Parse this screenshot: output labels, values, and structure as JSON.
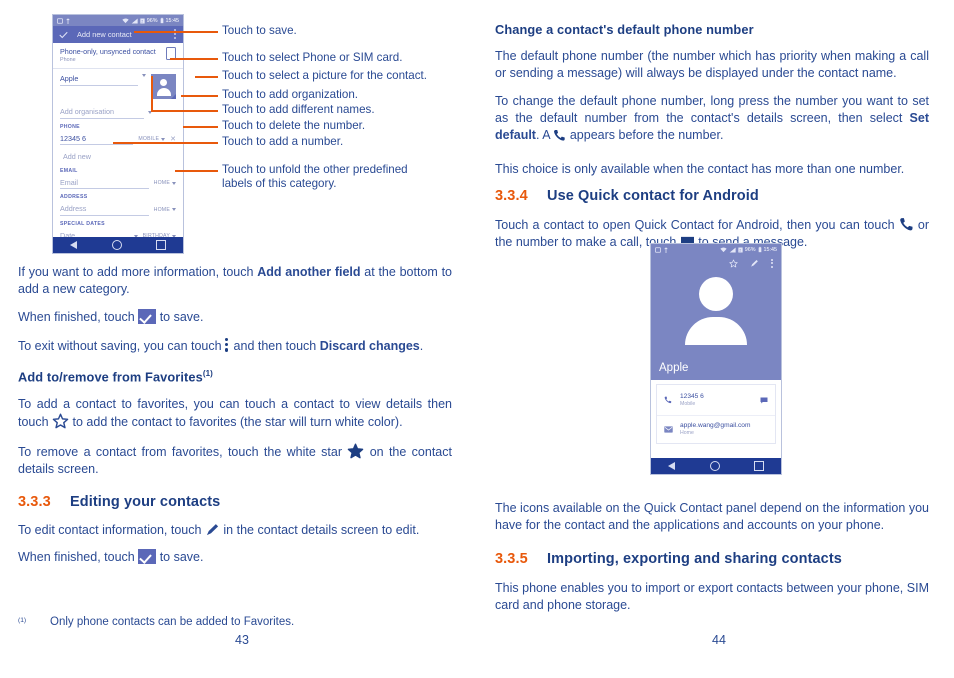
{
  "document": {
    "left_page_number": "43",
    "right_page_number": "44"
  },
  "colors": {
    "body_text": "#2a4a93",
    "heading": "#1d3e82",
    "accent_orange": "#e8590c",
    "phone_appbar": "#5b68b8",
    "phone_navbar": "#1f3a93",
    "phone_statusbar": "#7b86c2"
  },
  "left_column": {
    "phone_add_contact": {
      "statusbar": {
        "battery": "96%",
        "time": "15:45",
        "icons": [
          "sim-card-icon",
          "usb-icon",
          "wifi-icon",
          "signal-icon",
          "battery-icon"
        ]
      },
      "appbar": {
        "check_icon": "check-icon",
        "title": "Add new contact",
        "overflow_icon": "overflow-menu-icon"
      },
      "account_row": {
        "primary": "Phone-only, unsynced contact",
        "secondary": "Phone",
        "icon": "sim-card-icon"
      },
      "name_field": {
        "value": "Apple",
        "expand_icon": "chevron-down-icon"
      },
      "photo_icon": "contact-photo-icon",
      "organisation_field": {
        "placeholder": "Add organisation",
        "expand_icon": "chevron-down-icon"
      },
      "sections": [
        {
          "title": "PHONE",
          "rows": [
            {
              "value": "12345 6",
              "label": "MOBILE",
              "delete_icon": "close-icon"
            },
            {
              "value": "Add new",
              "label": ""
            }
          ]
        },
        {
          "title": "EMAIL",
          "rows": [
            {
              "value": "Email",
              "label": "HOME",
              "placeholder": true
            }
          ]
        },
        {
          "title": "ADDRESS",
          "rows": [
            {
              "value": "Address",
              "label": "HOME",
              "placeholder": true
            }
          ]
        },
        {
          "title": "SPECIAL DATES",
          "rows": [
            {
              "value": "Date",
              "label": "BIRTHDAY",
              "placeholder": true
            }
          ]
        }
      ],
      "navbar": [
        "back-icon",
        "home-icon",
        "recents-icon"
      ]
    },
    "callouts": [
      "Touch to save.",
      "Touch to select Phone or SIM card.",
      "Touch to select a picture for the contact.",
      "Touch to add organization.",
      "Touch to add different names.",
      "Touch to delete the number.",
      "Touch to add a number.",
      "Touch to unfold the other predefined labels of this category."
    ],
    "paragraphs": {
      "p1_pre": "If you want to add more information, touch ",
      "p1_bold": "Add another field",
      "p1_post": " at the bottom to add a new category.",
      "p2_pre": "When finished, touch ",
      "p2_post": " to save.",
      "p3_pre": "To exit without saving, you can touch ",
      "p3_mid": " and then touch ",
      "p3_bold": "Discard changes",
      "p3_post": ".",
      "sub_favorites": "Add to/remove from Favorites",
      "sub_favorites_mark": "(1)",
      "p4_pre": "To add a contact to favorites, you can touch a contact to view details then touch ",
      "p4_post": " to add the contact to favorites (the star will turn white color).",
      "p5_pre": "To remove a contact from favorites, touch the white star ",
      "p5_post": " on the contact details screen.",
      "section_333_num": "3.3.3",
      "section_333_title": "Editing your contacts",
      "p6_pre": "To edit contact information, touch ",
      "p6_post": " in the contact details screen to edit.",
      "p7_pre": "When finished, touch ",
      "p7_post": " to save.",
      "footnote_mark": "(1)",
      "footnote_text": "Only phone contacts can be added to Favorites."
    }
  },
  "right_column": {
    "sub_default_number": "Change a contact's default phone number",
    "p1": "The default phone number (the number which has priority when making a call or sending a message) will always be displayed under the contact name.",
    "p2_pre": "To change the default phone number, long press the number you want to set as the default number from the contact's details screen, then select ",
    "p2_bold": "Set default",
    "p2_mid": ". A ",
    "p2_post": " appears before the number.",
    "p3": "This choice is only available when the contact has more than one number.",
    "section_334_num": "3.3.4",
    "section_334_title": "Use Quick contact for Android",
    "p4_pre": "Touch a contact to open Quick Contact for Android, then you can touch ",
    "p4_mid": " or the number to make a call, touch ",
    "p4_post": " to send a message.",
    "phone_quick_contact": {
      "statusbar": {
        "battery": "96%",
        "time": "15:45"
      },
      "actions": [
        "star-outline-icon",
        "pencil-icon",
        "overflow-menu-icon"
      ],
      "contact_name": "Apple",
      "items": [
        {
          "icon": "phone-icon",
          "value": "12345 6",
          "label": "Mobile",
          "action_icon": "message-icon"
        },
        {
          "icon": "email-icon",
          "value": "apple.wang@gmail.com",
          "label": "Home"
        }
      ],
      "navbar": [
        "back-icon",
        "home-icon",
        "recents-icon"
      ]
    },
    "p5": "The icons available on the Quick Contact panel depend on the information you have for the contact and the applications and accounts on your phone.",
    "section_335_num": "3.3.5",
    "section_335_title": "Importing, exporting and sharing contacts",
    "p6": "This phone enables you to import or export contacts between your phone, SIM card and phone storage."
  }
}
